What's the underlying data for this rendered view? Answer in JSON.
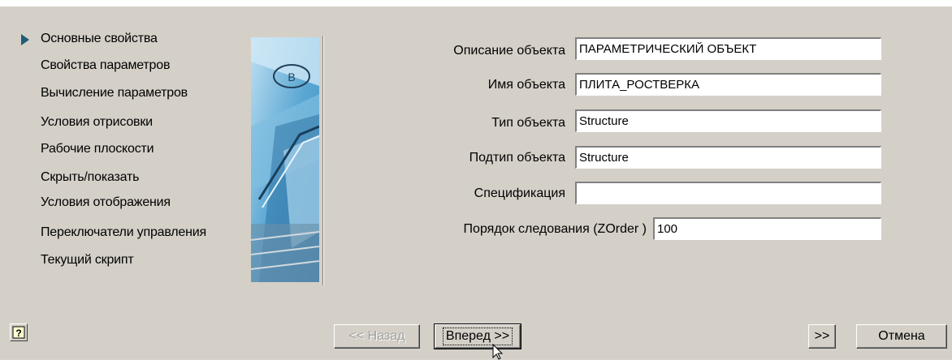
{
  "nav": {
    "items": [
      {
        "label": "Основные свойства",
        "active": true
      },
      {
        "label": "Свойства параметров",
        "active": false
      },
      {
        "label": "Вычисление параметров",
        "active": false
      },
      {
        "label": "Условия отрисовки",
        "active": false
      },
      {
        "label": "Рабочие плоскости",
        "active": false
      },
      {
        "label": "Скрыть/показать",
        "active": false
      },
      {
        "label": "Условия отображения",
        "active": false
      },
      {
        "label": "Переключатели управления",
        "active": false
      },
      {
        "label": "Текущий скрипт",
        "active": false
      }
    ]
  },
  "form": {
    "description": {
      "label": "Описание объекта",
      "value": "ПАРАМЕТРИЧЕСКИЙ ОБЪЕКТ"
    },
    "name": {
      "label": "Имя объекта",
      "value": "ПЛИТА_РОСТВЕРКА"
    },
    "type": {
      "label": "Тип объекта",
      "value": "Structure"
    },
    "subtype": {
      "label": "Подтип объекта",
      "value": "Structure"
    },
    "specification": {
      "label": "Спецификация",
      "value": ""
    },
    "zorder": {
      "label": "Порядок следования (ZOrder )",
      "value": "100"
    }
  },
  "buttons": {
    "help": "?",
    "back": "<< Назад",
    "next": "Вперед >>",
    "finish": ">>",
    "cancel": "Отмена"
  },
  "side_image_badge": "B",
  "colors": {
    "dialog_bg": "#d4d0c8",
    "nav_arrow": "#1f5c77",
    "input_bg": "#ffffff"
  },
  "icons": [
    "help-icon",
    "nav-arrow-icon",
    "mouse-cursor-icon"
  ]
}
